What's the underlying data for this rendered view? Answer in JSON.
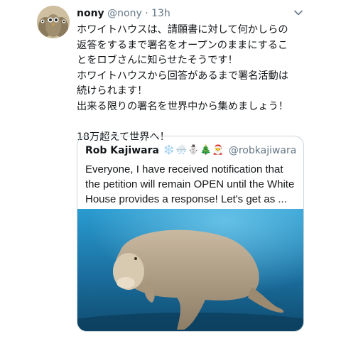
{
  "tweet": {
    "display_name": "nony",
    "handle": "@nony",
    "separator": "·",
    "time": "13h",
    "lines": [
      "ホワイトハウスは、請願書に対して何かしらの",
      "返答をするまで署名をオープンのままにするこ",
      "とをロブさんに知らせたそうです！",
      "ホワイトハウスから回答があるまで署名活動は",
      "続けられます！",
      "出来る限りの署名を世界中から集めましょう！",
      "",
      "18万超えて世界へ！"
    ]
  },
  "quote": {
    "name": "Rob Kajiwara",
    "emojis": "❄️🌨️⛄🎄🎅",
    "handle": "@robkajiwara",
    "text": "Everyone, I have received notification that the petition will remain OPEN until the White House provides a response! Let's get as ..."
  },
  "icons": {
    "menu": "chevron-down-icon"
  },
  "colors": {
    "text": "#14171a",
    "secondary": "#657786",
    "border": "#ccd6dd",
    "ocean": "#1b7fb0"
  }
}
